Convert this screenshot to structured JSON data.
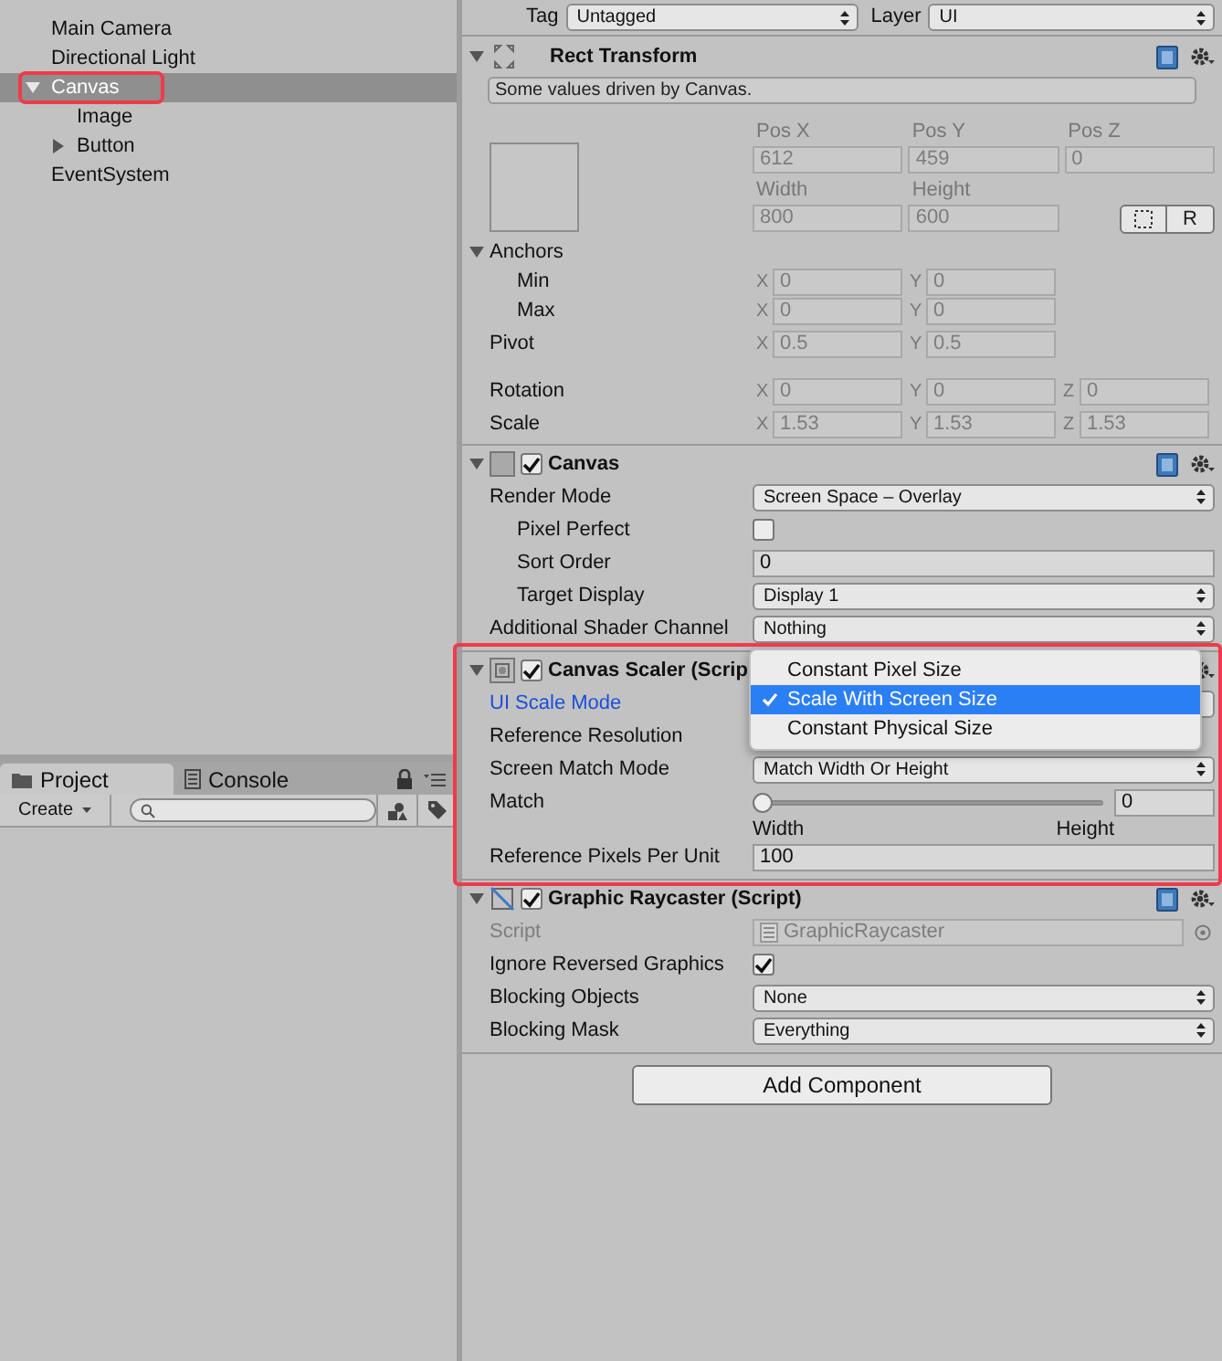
{
  "hierarchy": {
    "items": [
      {
        "label": "Main Camera",
        "selected": false
      },
      {
        "label": "Directional Light",
        "selected": false
      },
      {
        "label": "Canvas",
        "selected": true,
        "highlighted": true,
        "expanded": true,
        "children": [
          {
            "label": "Image",
            "selected": false
          },
          {
            "label": "Button",
            "selected": false,
            "expanded": false
          }
        ]
      },
      {
        "label": "EventSystem",
        "selected": false
      }
    ]
  },
  "project": {
    "tabs": [
      {
        "label": "Project",
        "selected": true
      },
      {
        "label": "Console",
        "selected": false
      }
    ],
    "create_button": "Create"
  },
  "inspector": {
    "tag_label": "Tag",
    "tag": "Untagged",
    "layer_label": "Layer",
    "layer": "UI",
    "rect_transform": {
      "title": "Rect Transform",
      "expanded": true,
      "notice": "Some values driven by Canvas.",
      "disabled": true,
      "position": [
        {
          "label": "Pos X",
          "value": "612"
        },
        {
          "label": "Pos Y",
          "value": "459"
        },
        {
          "label": "Pos Z",
          "value": "0"
        }
      ],
      "size": [
        {
          "label": "Width",
          "value": "800"
        },
        {
          "label": "Height",
          "value": "600"
        }
      ],
      "raw_button": "R",
      "anchors": {
        "label": "Anchors",
        "expanded": true,
        "rows": [
          {
            "label": "Min",
            "fields": [
              {
                "axis": "X",
                "value": "0"
              },
              {
                "axis": "Y",
                "value": "0"
              }
            ]
          },
          {
            "label": "Max",
            "fields": [
              {
                "axis": "X",
                "value": "0"
              },
              {
                "axis": "Y",
                "value": "0"
              }
            ]
          }
        ]
      },
      "rows": [
        {
          "label": "Pivot",
          "fields": [
            {
              "axis": "X",
              "value": "0.5"
            },
            {
              "axis": "Y",
              "value": "0.5"
            }
          ]
        },
        {
          "label": "Rotation",
          "fields": [
            {
              "axis": "X",
              "value": "0"
            },
            {
              "axis": "Y",
              "value": "0"
            },
            {
              "axis": "Z",
              "value": "0"
            }
          ]
        },
        {
          "label": "Scale",
          "fields": [
            {
              "axis": "X",
              "value": "1.53"
            },
            {
              "axis": "Y",
              "value": "1.53"
            },
            {
              "axis": "Z",
              "value": "1.53"
            }
          ]
        }
      ]
    },
    "components": [
      {
        "kind": "canvas",
        "title": "Canvas",
        "expanded": true,
        "enabled": true,
        "highlighted": false,
        "properties": [
          {
            "kind": "dropdown",
            "label": "Render Mode",
            "value": "Screen Space – Overlay",
            "children": [
              {
                "kind": "checkbox",
                "label": "Pixel Perfect",
                "checked": false
              },
              {
                "kind": "number",
                "label": "Sort Order",
                "value": "0"
              },
              {
                "kind": "dropdown",
                "label": "Target Display",
                "value": "Display 1"
              }
            ]
          },
          {
            "kind": "dropdown",
            "label": "Additional Shader Channel",
            "value": "Nothing"
          }
        ]
      },
      {
        "kind": "canvas_scaler",
        "title": "Canvas Scaler (Scrip",
        "expanded": true,
        "enabled": true,
        "highlighted": true,
        "properties": [
          {
            "kind": "dropdown",
            "label": "UI Scale Mode",
            "focused": true,
            "open": true,
            "options": [
              {
                "label": "Constant Pixel Size",
                "selected": false
              },
              {
                "label": "Scale With Screen Size",
                "selected": true
              },
              {
                "label": "Constant Physical Size",
                "selected": false
              }
            ]
          },
          {
            "kind": "vector",
            "label": "Reference Resolution"
          },
          {
            "kind": "dropdown",
            "label": "Screen Match Mode",
            "value": "Match Width Or Height"
          },
          {
            "kind": "slider",
            "label": "Match",
            "level": 0,
            "value": "0",
            "min_label": "Width",
            "max_label": "Height"
          },
          {
            "kind": "number",
            "label": "Reference Pixels Per Unit",
            "value": "100"
          }
        ]
      },
      {
        "kind": "graphic_raycaster",
        "title": "Graphic Raycaster (Script)",
        "expanded": true,
        "enabled": true,
        "highlighted": false,
        "properties": [
          {
            "kind": "object",
            "label": "Script",
            "value": "GraphicRaycaster",
            "disabled": true
          },
          {
            "kind": "checkbox",
            "label": "Ignore Reversed Graphics",
            "checked": true
          },
          {
            "kind": "dropdown",
            "label": "Blocking Objects",
            "value": "None"
          },
          {
            "kind": "dropdown",
            "label": "Blocking Mask",
            "value": "Everything"
          }
        ]
      }
    ],
    "add_component_button": "Add Component"
  }
}
